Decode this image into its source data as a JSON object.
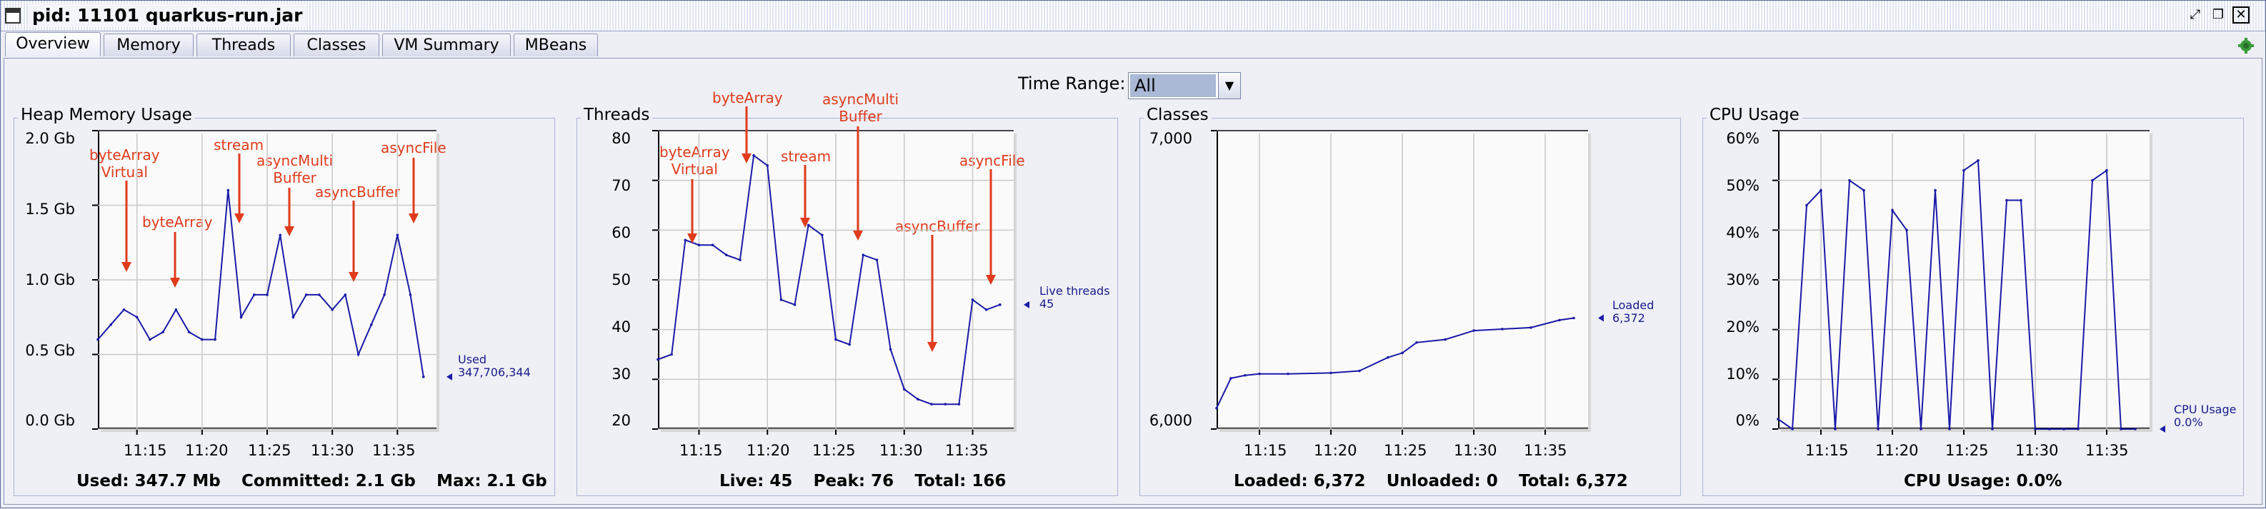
{
  "window": {
    "title": "pid: 11101 quarkus-run.jar"
  },
  "tabs": [
    "Overview",
    "Memory",
    "Threads",
    "Classes",
    "VM Summary",
    "MBeans"
  ],
  "time_range": {
    "label": "Time Range:",
    "value": "All"
  },
  "colors": {
    "series": "#1a1aa8",
    "annotation": "#e03b1c",
    "plot_bg": "#fafafa"
  },
  "x_ticks": [
    "11:15",
    "11:20",
    "11:25",
    "11:30",
    "11:35"
  ],
  "heap": {
    "title": "Heap Memory Usage",
    "y_ticks": [
      "2.0 Gb",
      "1.5 Gb",
      "1.0 Gb",
      "0.5 Gb",
      "0.0 Gb"
    ],
    "legend": [
      "Used",
      "347,706,344"
    ],
    "footer": {
      "used": "Used: 347.7 Mb",
      "committed": "Committed: 2.1 Gb",
      "max": "Max: 2.1 Gb"
    },
    "annotations": [
      {
        "text": [
          "byteArray",
          "Virtual"
        ]
      },
      {
        "text": [
          "byteArray"
        ]
      },
      {
        "text": [
          "stream"
        ]
      },
      {
        "text": [
          "asyncMulti",
          "Buffer"
        ]
      },
      {
        "text": [
          "asyncBuffer"
        ]
      },
      {
        "text": [
          "asyncFile"
        ]
      }
    ]
  },
  "threads": {
    "title": "Threads",
    "y_ticks": [
      "80",
      "70",
      "60",
      "50",
      "40",
      "30",
      "20"
    ],
    "legend": [
      "Live threads",
      "45"
    ],
    "footer": {
      "live": "Live: 45",
      "peak": "Peak: 76",
      "total": "Total: 166"
    },
    "annotations": [
      {
        "text": [
          "byteArray",
          "Virtual"
        ]
      },
      {
        "text": [
          "byteArray"
        ]
      },
      {
        "text": [
          "stream"
        ]
      },
      {
        "text": [
          "asyncMulti",
          "Buffer"
        ]
      },
      {
        "text": [
          "asyncBuffer"
        ]
      },
      {
        "text": [
          "asyncFile"
        ]
      }
    ]
  },
  "classes": {
    "title": "Classes",
    "y_ticks": [
      "7,000",
      "6,000"
    ],
    "legend": [
      "Loaded",
      "6,372"
    ],
    "footer": {
      "loaded": "Loaded: 6,372",
      "unloaded": "Unloaded: 0",
      "total": "Total: 6,372"
    }
  },
  "cpu": {
    "title": "CPU Usage",
    "y_ticks": [
      "60%",
      "50%",
      "40%",
      "30%",
      "20%",
      "10%",
      "0%"
    ],
    "legend": [
      "CPU Usage",
      "0.0%"
    ],
    "footer": {
      "usage": "CPU Usage: 0.0%"
    }
  },
  "chart_data": [
    {
      "type": "line",
      "title": "Heap Memory Usage",
      "x_unit": "time",
      "ylim": [
        0,
        2.0
      ],
      "y_unit": "Gb",
      "series": [
        {
          "name": "Used",
          "x": [
            "11:12",
            "11:13",
            "11:14",
            "11:15",
            "11:16",
            "11:17",
            "11:18",
            "11:19",
            "11:20",
            "11:21",
            "11:22",
            "11:23",
            "11:24",
            "11:25",
            "11:26",
            "11:27",
            "11:28",
            "11:29",
            "11:30",
            "11:31",
            "11:32",
            "11:33",
            "11:34",
            "11:35",
            "11:36",
            "11:37"
          ],
          "values": [
            0.6,
            0.7,
            0.8,
            0.75,
            0.6,
            0.65,
            0.8,
            0.65,
            0.6,
            0.6,
            1.6,
            0.75,
            0.9,
            0.9,
            1.3,
            0.75,
            0.9,
            0.9,
            0.8,
            0.9,
            0.5,
            0.7,
            0.9,
            1.3,
            0.9,
            0.35
          ]
        }
      ]
    },
    {
      "type": "line",
      "title": "Threads",
      "ylim": [
        20,
        80
      ],
      "series": [
        {
          "name": "Live threads",
          "x": [
            "11:12",
            "11:13",
            "11:14",
            "11:15",
            "11:16",
            "11:17",
            "11:18",
            "11:19",
            "11:20",
            "11:21",
            "11:22",
            "11:23",
            "11:24",
            "11:25",
            "11:26",
            "11:27",
            "11:28",
            "11:29",
            "11:30",
            "11:31",
            "11:32",
            "11:33",
            "11:34",
            "11:35",
            "11:36",
            "11:37"
          ],
          "values": [
            34,
            35,
            58,
            57,
            57,
            55,
            54,
            75,
            73,
            46,
            45,
            61,
            59,
            38,
            37,
            55,
            54,
            36,
            28,
            26,
            25,
            25,
            25,
            46,
            44,
            45
          ]
        }
      ]
    },
    {
      "type": "line",
      "title": "Classes",
      "ylim": [
        6000,
        7000
      ],
      "series": [
        {
          "name": "Loaded",
          "x": [
            "11:12",
            "11:13",
            "11:14",
            "11:15",
            "11:17",
            "11:20",
            "11:22",
            "11:24",
            "11:25",
            "11:26",
            "11:28",
            "11:30",
            "11:32",
            "11:34",
            "11:36",
            "11:37"
          ],
          "values": [
            6070,
            6170,
            6180,
            6185,
            6185,
            6188,
            6195,
            6240,
            6255,
            6290,
            6300,
            6330,
            6335,
            6340,
            6365,
            6372
          ]
        }
      ]
    },
    {
      "type": "line",
      "title": "CPU Usage",
      "ylim": [
        0,
        60
      ],
      "y_unit": "%",
      "series": [
        {
          "name": "CPU Usage",
          "x": [
            "11:12",
            "11:13",
            "11:14",
            "11:15",
            "11:16",
            "11:17",
            "11:18",
            "11:19",
            "11:20",
            "11:21",
            "11:22",
            "11:23",
            "11:24",
            "11:25",
            "11:26",
            "11:27",
            "11:28",
            "11:29",
            "11:30",
            "11:31",
            "11:32",
            "11:33",
            "11:34",
            "11:35",
            "11:36",
            "11:37"
          ],
          "values": [
            2,
            0,
            45,
            48,
            0,
            50,
            48,
            0,
            44,
            40,
            0,
            48,
            0,
            52,
            54,
            0,
            46,
            46,
            0,
            0,
            0,
            0,
            50,
            52,
            0,
            0
          ]
        }
      ]
    }
  ]
}
